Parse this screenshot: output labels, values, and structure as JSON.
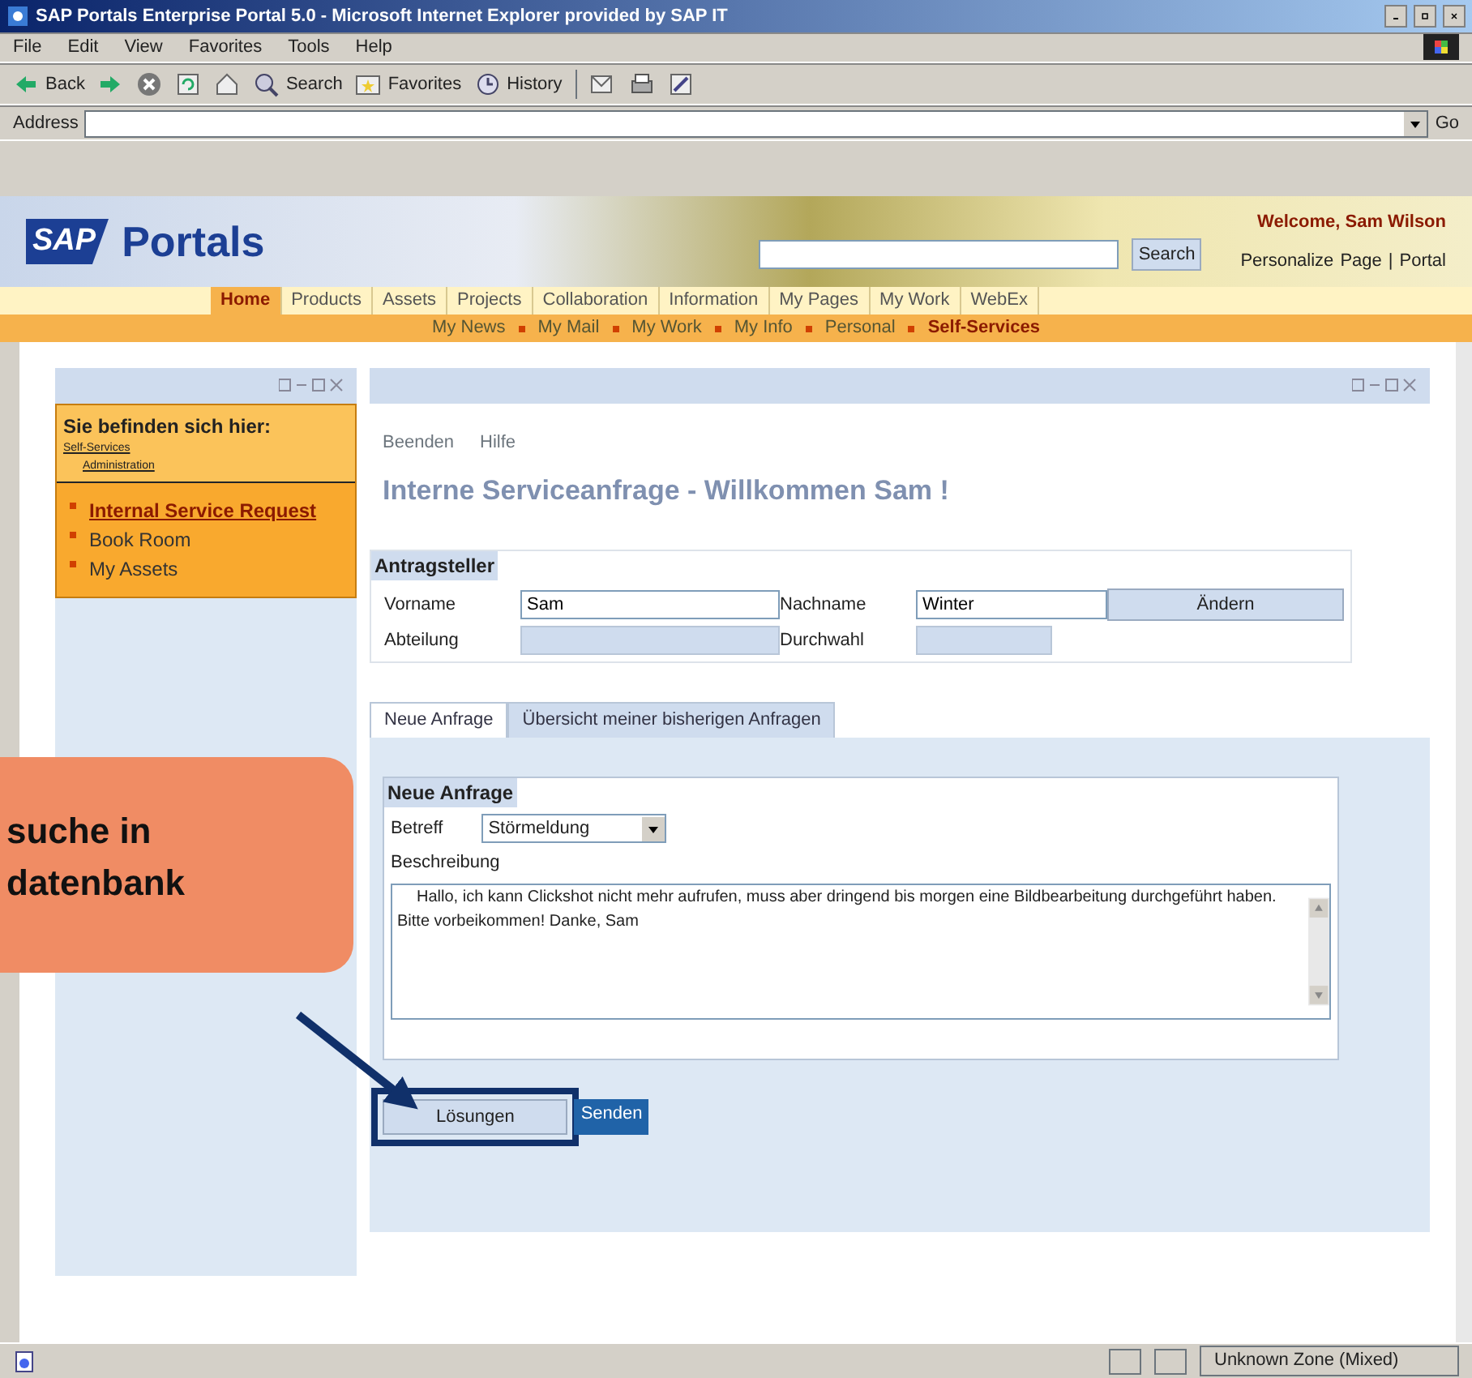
{
  "window": {
    "title": "SAP Portals Enterprise Portal 5.0 - Microsoft Internet Explorer provided by SAP IT"
  },
  "menu": [
    "File",
    "Edit",
    "View",
    "Favorites",
    "Tools",
    "Help"
  ],
  "toolbar": [
    {
      "kind": "back",
      "label": "Back"
    },
    {
      "kind": "forward"
    },
    {
      "kind": "stop"
    },
    {
      "kind": "refresh"
    },
    {
      "kind": "home"
    },
    {
      "kind": "search",
      "label": "Search"
    },
    {
      "kind": "favorites",
      "label": "Favorites"
    },
    {
      "kind": "history",
      "label": "History"
    },
    {
      "kind": "mail"
    },
    {
      "kind": "print"
    },
    {
      "kind": "edit"
    }
  ],
  "address": {
    "label": "Address",
    "go": "Go"
  },
  "header": {
    "logo_mark": "SAP",
    "logo_text": "Portals",
    "search_button": "Search",
    "welcome": "Welcome, Sam Wilson",
    "links": [
      "Personalize",
      "Page",
      "Portal"
    ],
    "separator": "|"
  },
  "top_nav": [
    {
      "label": "Home",
      "selected": true
    },
    {
      "label": "Products",
      "selected": false
    },
    {
      "label": "Assets",
      "selected": false
    },
    {
      "label": "Projects",
      "selected": false
    },
    {
      "label": "Collaboration",
      "selected": false
    },
    {
      "label": "Information",
      "selected": false
    },
    {
      "label": "My Pages",
      "selected": false
    },
    {
      "label": "My Work",
      "selected": false
    },
    {
      "label": "WebEx",
      "selected": false
    }
  ],
  "sub_nav": [
    {
      "label": "My News",
      "selected": false
    },
    {
      "label": "My Mail",
      "selected": false
    },
    {
      "label": "My Work",
      "selected": false
    },
    {
      "label": "My Info",
      "selected": false
    },
    {
      "label": "Personal",
      "selected": false
    },
    {
      "label": "Self-Services",
      "selected": true
    }
  ],
  "sidebar": {
    "title": "Sie befinden sich hier:",
    "breadcrumb": [
      "Self-Services",
      "Administration"
    ],
    "items": [
      {
        "label": "Internal Service Request",
        "selected": true
      },
      {
        "label": "Book Room",
        "selected": false
      },
      {
        "label": "My Assets",
        "selected": false
      }
    ]
  },
  "main": {
    "links": [
      "Beenden",
      "Hilfe"
    ],
    "heading": "Interne Serviceanfrage - Willkommen Sam !",
    "applicant": {
      "title": "Antragsteller",
      "fields": [
        {
          "label": "Vorname",
          "value": "Sam",
          "disabled": false
        },
        {
          "label": "Nachname",
          "value": "Winter",
          "disabled": false
        },
        {
          "label": "Abteilung",
          "disabled": true
        },
        {
          "label": "Durchwahl",
          "disabled": true
        }
      ],
      "button": "Ändern"
    },
    "tabs": [
      {
        "label": "Neue Anfrage",
        "selected": true
      },
      {
        "label": "Übersicht meiner bisherigen Anfragen",
        "selected": false
      }
    ],
    "request": {
      "title": "Neue Anfrage",
      "subject_label": "Betreff",
      "subject": "Störmeldung",
      "description_label": "Beschreibung",
      "description": "Hallo, ich kann Clickshot nicht mehr aufrufen, muss aber dringend bis morgen eine Bildbearbeitung durchgeführt haben. Bitte vorbeikommen! Danke, Sam"
    },
    "buttons": [
      {
        "label": "Lösungen",
        "kind": "normal",
        "highlighted": true
      },
      {
        "label": "Senden",
        "kind": "primary",
        "highlighted": false
      }
    ]
  },
  "callout": {
    "lines": [
      "suche in",
      "datenbank"
    ]
  },
  "status_bar": {
    "zone": "Unknown Zone (Mixed)"
  }
}
